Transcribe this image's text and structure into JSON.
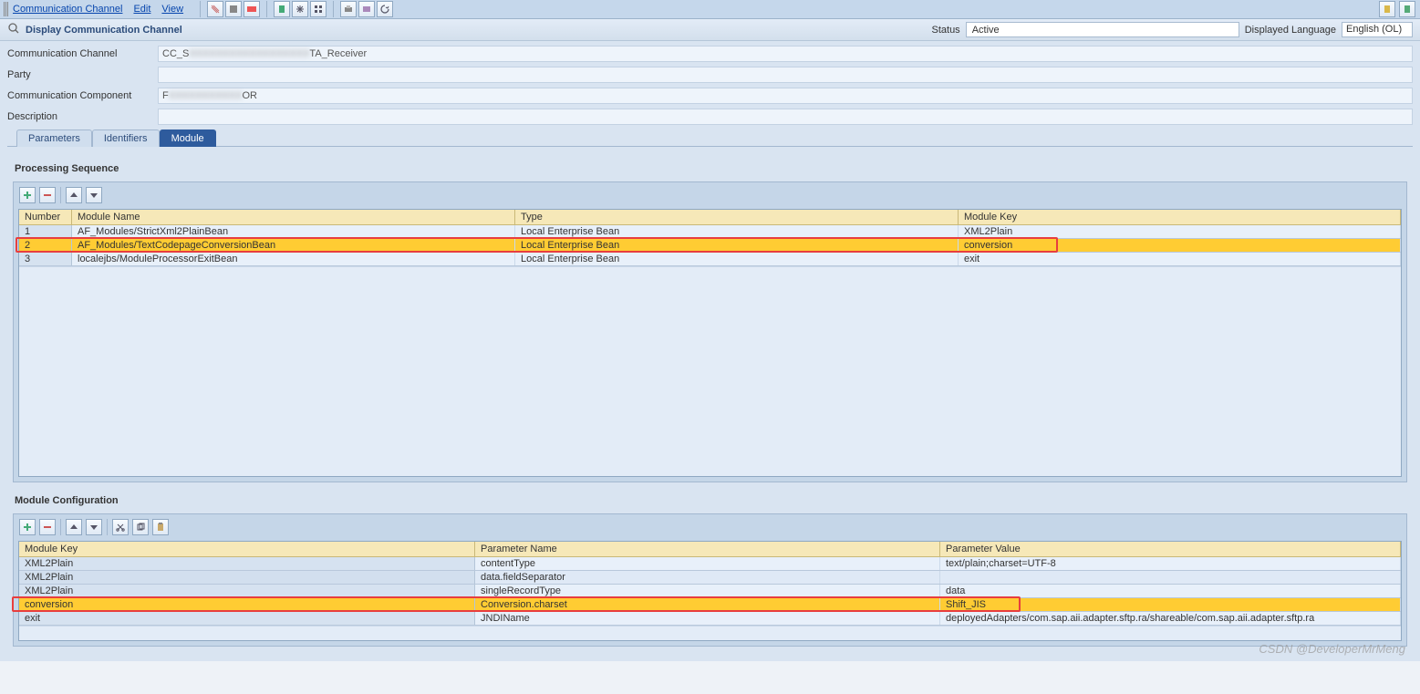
{
  "menu": {
    "items": [
      "Communication Channel",
      "Edit",
      "View"
    ]
  },
  "page_title": "Display Communication Channel",
  "status": {
    "label": "Status",
    "value": "Active"
  },
  "displayed_language": {
    "label": "Displayed Language",
    "value": "English (OL)"
  },
  "header_fields": {
    "comm_channel": {
      "label": "Communication Channel",
      "prefix": "CC_S",
      "suffix": "TA_Receiver"
    },
    "party": {
      "label": "Party",
      "value": ""
    },
    "comm_component": {
      "label": "Communication Component",
      "prefix": "F",
      "suffix": "OR"
    },
    "description": {
      "label": "Description",
      "value": ""
    }
  },
  "tabs": [
    "Parameters",
    "Identifiers",
    "Module"
  ],
  "active_tab_index": 2,
  "processing_sequence": {
    "title": "Processing Sequence",
    "columns": [
      "Number",
      "Module Name",
      "Type",
      "Module Key"
    ],
    "rows": [
      {
        "number": "1",
        "module_name": "AF_Modules/StrictXml2PlainBean",
        "type": "Local Enterprise Bean",
        "module_key": "XML2Plain"
      },
      {
        "number": "2",
        "module_name": "AF_Modules/TextCodepageConversionBean",
        "type": "Local Enterprise Bean",
        "module_key": "conversion"
      },
      {
        "number": "3",
        "module_name": "localejbs/ModuleProcessorExitBean",
        "type": "Local Enterprise Bean",
        "module_key": "exit"
      }
    ],
    "highlight_index": 1
  },
  "module_configuration": {
    "title": "Module Configuration",
    "columns": [
      "Module Key",
      "Parameter Name",
      "Parameter Value"
    ],
    "rows": [
      {
        "module_key": "XML2Plain",
        "parameter_name": "contentType",
        "parameter_value": "text/plain;charset=UTF-8"
      },
      {
        "module_key": "XML2Plain",
        "parameter_name": "data.fieldSeparator",
        "parameter_value": ""
      },
      {
        "module_key": "XML2Plain",
        "parameter_name": "singleRecordType",
        "parameter_value": "data"
      },
      {
        "module_key": "conversion",
        "parameter_name": "Conversion.charset",
        "parameter_value": "Shift_JIS"
      },
      {
        "module_key": "exit",
        "parameter_name": "JNDIName",
        "parameter_value": "deployedAdapters/com.sap.aii.adapter.sftp.ra/shareable/com.sap.aii.adapter.sftp.ra"
      }
    ],
    "highlight_index": 3
  },
  "watermark": "CSDN @DeveloperMrMeng"
}
